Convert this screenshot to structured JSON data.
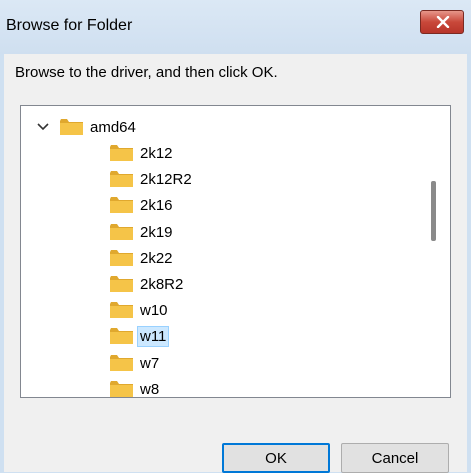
{
  "window": {
    "title": "Browse for Folder",
    "close_label": "Close"
  },
  "instruction": "Browse to the driver, and then click OK.",
  "tree": {
    "parent": {
      "label": "amd64",
      "expanded": true
    },
    "children": [
      {
        "label": "2k12",
        "selected": false
      },
      {
        "label": "2k12R2",
        "selected": false
      },
      {
        "label": "2k16",
        "selected": false
      },
      {
        "label": "2k19",
        "selected": false
      },
      {
        "label": "2k22",
        "selected": false
      },
      {
        "label": "2k8R2",
        "selected": false
      },
      {
        "label": "w10",
        "selected": false
      },
      {
        "label": "w11",
        "selected": true
      },
      {
        "label": "w7",
        "selected": false
      },
      {
        "label": "w8",
        "selected": false
      }
    ]
  },
  "buttons": {
    "ok": "OK",
    "cancel": "Cancel"
  },
  "colors": {
    "folder": "#f5c448",
    "folder_dark": "#e0a82e",
    "selection": "#cce8ff",
    "accent": "#0078d7"
  }
}
